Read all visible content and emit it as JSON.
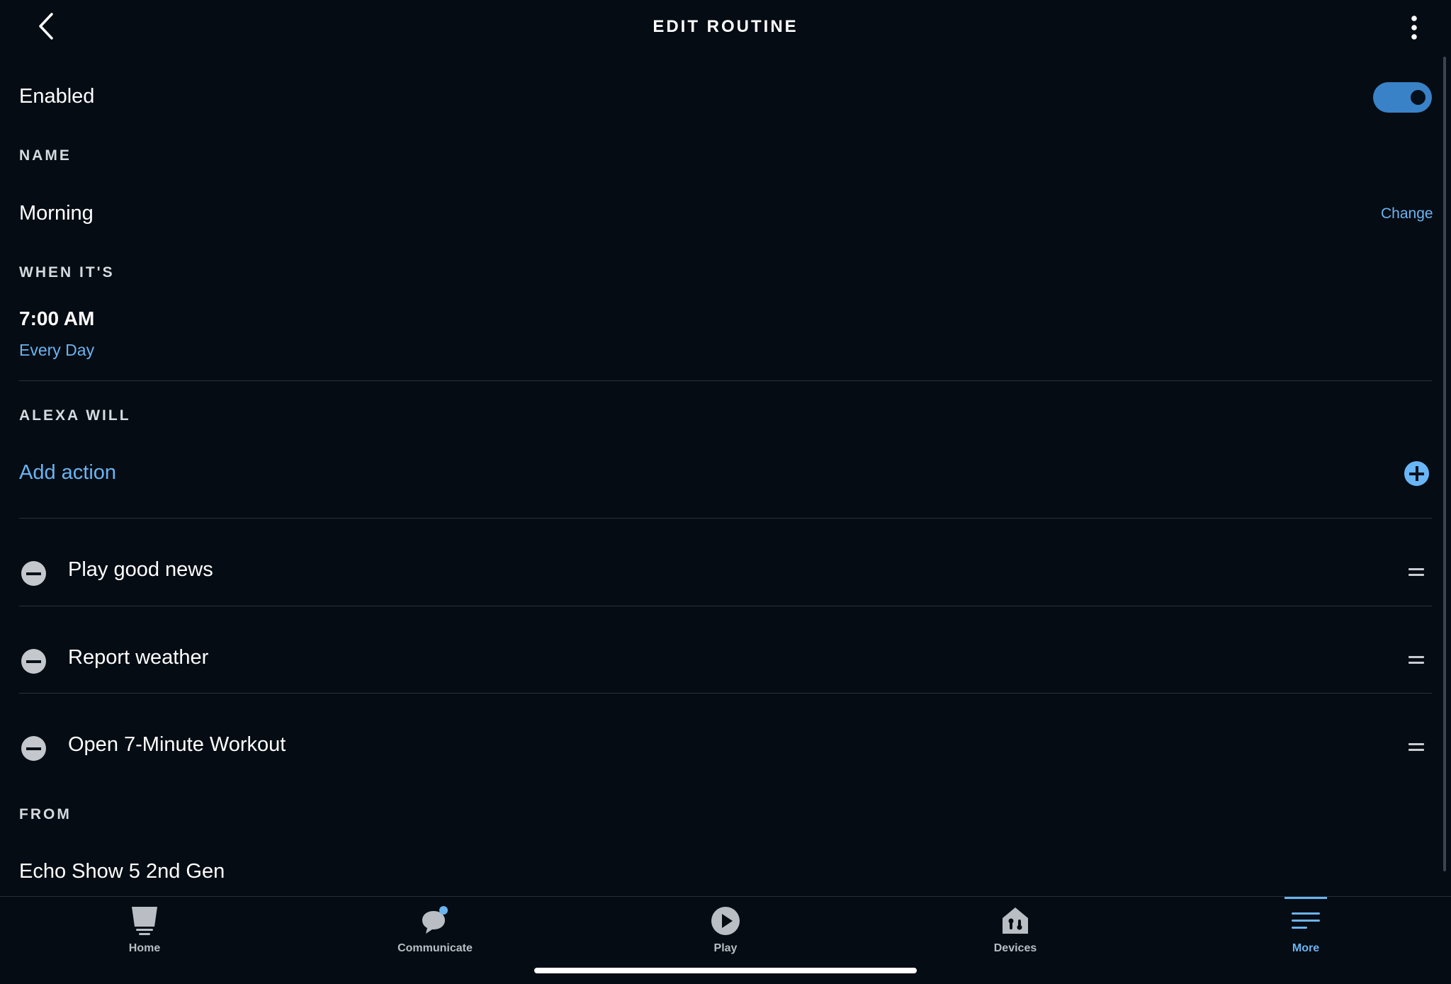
{
  "header": {
    "title": "EDIT ROUTINE"
  },
  "enabled": {
    "label": "Enabled",
    "state": "on"
  },
  "name": {
    "section_label": "NAME",
    "value": "Morning",
    "change_label": "Change"
  },
  "schedule": {
    "section_label": "WHEN IT'S",
    "time": "7:00 AM",
    "frequency": "Every Day"
  },
  "actions": {
    "section_label": "ALEXA WILL",
    "add_label": "Add action",
    "items": [
      {
        "label": "Play good news"
      },
      {
        "label": "Report weather"
      },
      {
        "label": "Open 7-Minute Workout"
      }
    ]
  },
  "from": {
    "section_label": "FROM",
    "device": "Echo Show 5 2nd Gen"
  },
  "bottom_nav": {
    "items": [
      {
        "label": "Home",
        "icon": "home-icon"
      },
      {
        "label": "Communicate",
        "icon": "communicate-icon",
        "badge": true
      },
      {
        "label": "Play",
        "icon": "play-icon"
      },
      {
        "label": "Devices",
        "icon": "devices-icon"
      },
      {
        "label": "More",
        "icon": "more-icon",
        "active": true
      }
    ]
  },
  "colors": {
    "background": "#050c14",
    "accent": "#6ab4f0",
    "toggle_on": "#3a82c8"
  }
}
